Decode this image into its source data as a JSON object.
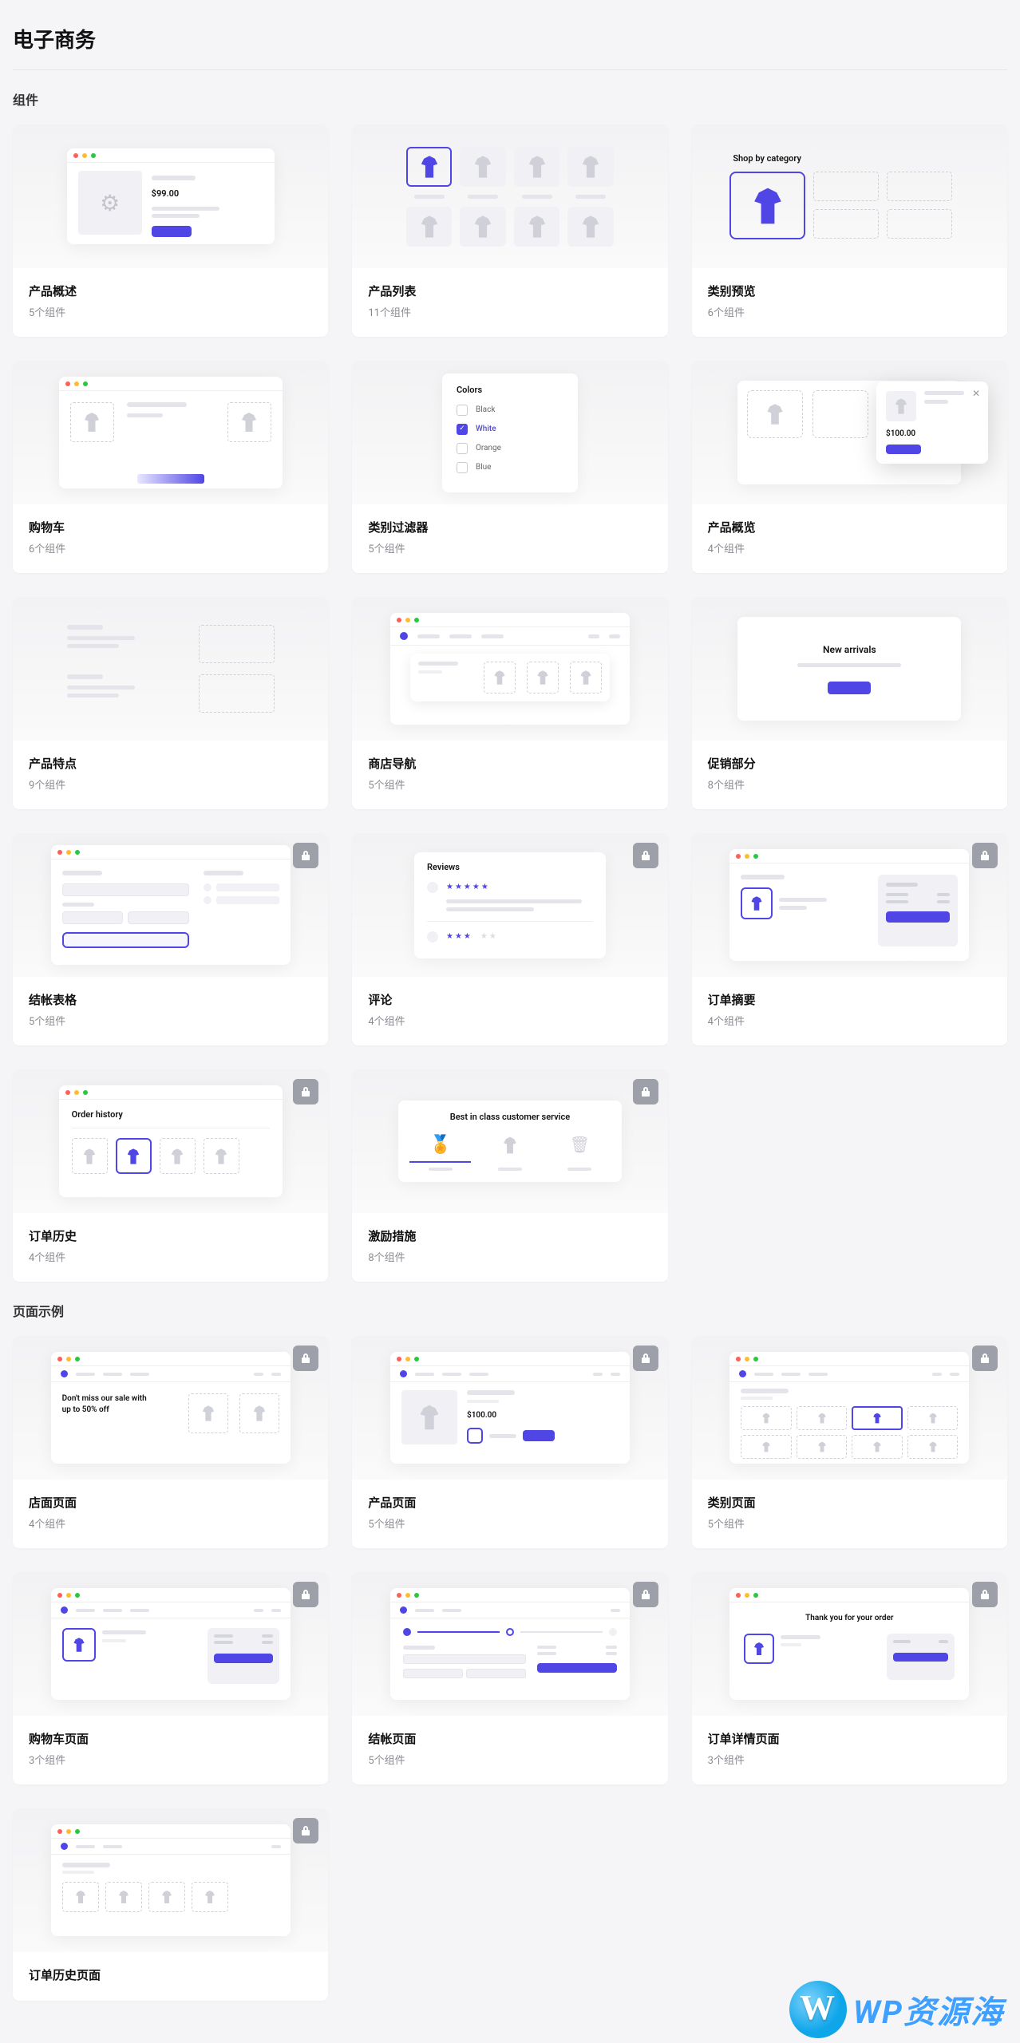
{
  "page_title": "电子商务",
  "sections": [
    {
      "title": "组件",
      "cards": [
        {
          "title": "产品概述",
          "sub": "5个组件",
          "locked": false,
          "preview": "pv-overview",
          "pdata": {
            "price": "$99.00"
          }
        },
        {
          "title": "产品列表",
          "sub": "11个组件",
          "locked": false,
          "preview": "pv-list"
        },
        {
          "title": "类别预览",
          "sub": "6个组件",
          "locked": false,
          "preview": "pv-category-preview",
          "pdata": {
            "label": "Shop by category"
          }
        },
        {
          "title": "购物车",
          "sub": "6个组件",
          "locked": false,
          "preview": "pv-cart"
        },
        {
          "title": "类别过滤器",
          "sub": "5个组件",
          "locked": false,
          "preview": "pv-filters",
          "pdata": {
            "heading": "Colors",
            "options": [
              "Black",
              "White",
              "Orange",
              "Blue"
            ],
            "checked": 1
          }
        },
        {
          "title": "产品概览",
          "sub": "4个组件",
          "locked": false,
          "preview": "pv-quickview",
          "pdata": {
            "price": "$100.00"
          }
        },
        {
          "title": "产品特点",
          "sub": "9个组件",
          "locked": false,
          "preview": "pv-features"
        },
        {
          "title": "商店导航",
          "sub": "5个组件",
          "locked": false,
          "preview": "pv-nav"
        },
        {
          "title": "促销部分",
          "sub": "8个组件",
          "locked": false,
          "preview": "pv-promo",
          "pdata": {
            "label": "New arrivals"
          }
        },
        {
          "title": "结帐表格",
          "sub": "5个组件",
          "locked": true,
          "preview": "pv-checkout-form"
        },
        {
          "title": "评论",
          "sub": "4个组件",
          "locked": true,
          "preview": "pv-reviews",
          "pdata": {
            "label": "Reviews"
          }
        },
        {
          "title": "订单摘要",
          "sub": "4个组件",
          "locked": true,
          "preview": "pv-order-summary"
        },
        {
          "title": "订单历史",
          "sub": "4个组件",
          "locked": true,
          "preview": "pv-order-history",
          "pdata": {
            "label": "Order history"
          }
        },
        {
          "title": "激励措施",
          "sub": "8个组件",
          "locked": true,
          "preview": "pv-incentives",
          "pdata": {
            "label": "Best in class customer service"
          }
        }
      ]
    },
    {
      "title": "页面示例",
      "cards": [
        {
          "title": "店面页面",
          "sub": "4个组件",
          "locked": true,
          "preview": "pv-storefront",
          "pdata": {
            "label": "Don't miss our sale with up to 50% off"
          }
        },
        {
          "title": "产品页面",
          "sub": "5个组件",
          "locked": true,
          "preview": "pv-product-page",
          "pdata": {
            "price": "$100.00"
          }
        },
        {
          "title": "类别页面",
          "sub": "5个组件",
          "locked": true,
          "preview": "pv-category-page"
        },
        {
          "title": "购物车页面",
          "sub": "3个组件",
          "locked": true,
          "preview": "pv-cart-page"
        },
        {
          "title": "结帐页面",
          "sub": "5个组件",
          "locked": true,
          "preview": "pv-checkout-page"
        },
        {
          "title": "订单详情页面",
          "sub": "3个组件",
          "locked": true,
          "preview": "pv-order-detail",
          "pdata": {
            "label": "Thank you for your order"
          }
        },
        {
          "title": "订单历史页面",
          "sub": "",
          "locked": true,
          "preview": "pv-order-history-page"
        }
      ]
    }
  ],
  "watermark": "WP资源海"
}
